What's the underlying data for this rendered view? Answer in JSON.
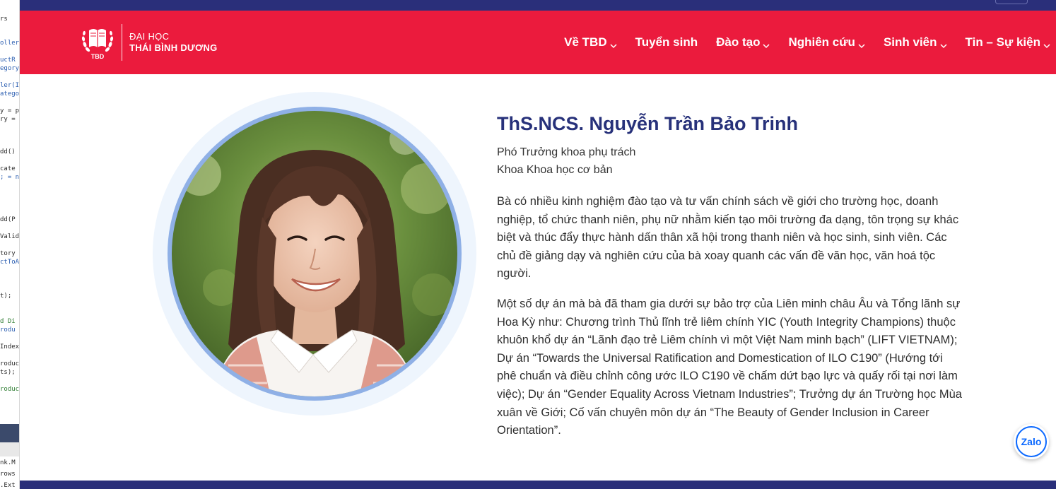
{
  "ide_strip": {
    "lines": [
      {
        "text": "rs",
        "style": ""
      },
      {
        "text": "oller",
        "style": "blue"
      },
      {
        "text": "uctR",
        "style": "blue"
      },
      {
        "text": "egory",
        "style": "blue"
      },
      {
        "text": "ler(I",
        "style": "blue"
      },
      {
        "text": "atego",
        "style": "blue"
      },
      {
        "text": "y = p",
        "style": ""
      },
      {
        "text": "ry =",
        "style": ""
      },
      {
        "text": "dd()",
        "style": ""
      },
      {
        "text": "cate",
        "style": ""
      },
      {
        "text": "; = n",
        "style": "blue"
      },
      {
        "text": "dd(P",
        "style": ""
      },
      {
        "text": "Valid",
        "style": ""
      },
      {
        "text": "tory",
        "style": ""
      },
      {
        "text": "ctToA",
        "style": "blue"
      },
      {
        "text": "t);",
        "style": ""
      },
      {
        "text": "d Di",
        "style": "green"
      },
      {
        "text": "rodu",
        "style": "blue"
      },
      {
        "text": "Index",
        "style": ""
      },
      {
        "text": "roduc",
        "style": ""
      },
      {
        "text": "ts);",
        "style": ""
      },
      {
        "text": "roduc",
        "style": "green"
      },
      {
        "text": "nk.M",
        "style": ""
      },
      {
        "text": "rows",
        "style": ""
      },
      {
        "text": ".Ext",
        "style": ""
      }
    ]
  },
  "header": {
    "logo": {
      "mark_text": "TBD",
      "line1": "ĐẠI HỌC",
      "line2": "THÁI BÌNH DƯƠNG"
    },
    "nav": [
      {
        "label": "Về TBD",
        "has_dropdown": true
      },
      {
        "label": "Tuyển sinh",
        "has_dropdown": false
      },
      {
        "label": "Đào tạo",
        "has_dropdown": true
      },
      {
        "label": "Nghiên cứu",
        "has_dropdown": true
      },
      {
        "label": "Sinh viên",
        "has_dropdown": true
      },
      {
        "label": "Tin – Sự kiện",
        "has_dropdown": true
      }
    ]
  },
  "profile": {
    "name": "ThS.NCS. Nguyễn Trần Bảo Trinh",
    "role_line1": "Phó Trưởng khoa phụ trách",
    "role_line2": "Khoa Khoa học cơ bản",
    "paragraph1": "Bà có nhiều kinh nghiệm đào tạo và tư vấn chính sách về giới cho trường học, doanh nghiệp, tổ chức thanh niên, phụ nữ nhằm kiến tạo môi trường đa dạng, tôn trọng sự khác biệt và thúc đẩy thực hành dấn thân xã hội trong thanh niên và học sinh, sinh viên. Các chủ đề giảng dạy và nghiên cứu của bà xoay quanh các vấn đề văn học, văn hoá tộc người.",
    "paragraph2": "Một số dự án mà bà đã tham gia dưới sự bảo trợ của Liên minh châu Âu và Tổng lãnh sự Hoa Kỳ như: Chương trình Thủ lĩnh trẻ liêm chính YIC (Youth Integrity Champions) thuộc khuôn khổ dự án “Lãnh đạo trẻ Liêm chính vì một Việt Nam minh bạch” (LIFT VIETNAM); Dự án “Towards the Universal Ratification and Domestication of ILO C190” (Hướng tới phê chuẩn và điều chỉnh công ước ILO C190 về chấm dứt bạo lực và quấy rối tại nơi làm việc); Dự án “Gender Equality Across Vietnam Industries”; Trưởng dự án Trường học Mùa xuân về Giới; Cố vấn chuyên môn dự án “The Beauty of Gender Inclusion in Career Orientation”."
  },
  "zalo": {
    "label": "Zalo"
  },
  "colors": {
    "header_red": "#eb1b3d",
    "navy": "#2a2f7a",
    "name_blue": "#27317a",
    "ring_blue": "#8fb0e6",
    "zalo_blue": "#0a68ff"
  }
}
